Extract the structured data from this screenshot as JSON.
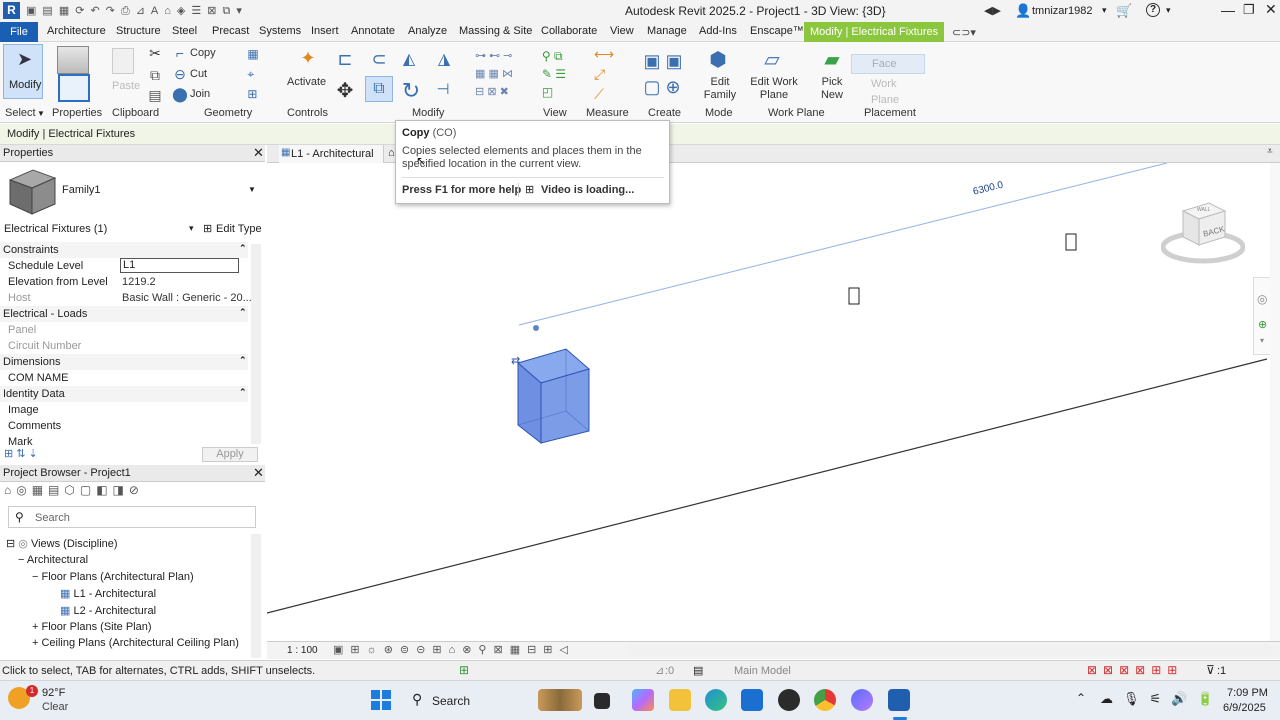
{
  "titlebar": {
    "title": "Autodesk Revit 2025.2 - Project1 - 3D View: {3D}",
    "user": "tmnizar1982",
    "app_icon_letter": "R"
  },
  "ribbon_tabs": [
    {
      "label": "File"
    },
    {
      "label": "Architecture"
    },
    {
      "label": "Structure"
    },
    {
      "label": "Steel"
    },
    {
      "label": "Precast"
    },
    {
      "label": "Systems"
    },
    {
      "label": "Insert"
    },
    {
      "label": "Annotate"
    },
    {
      "label": "Analyze"
    },
    {
      "label": "Massing & Site"
    },
    {
      "label": "Collaborate"
    },
    {
      "label": "View"
    },
    {
      "label": "Manage"
    },
    {
      "label": "Add-Ins"
    },
    {
      "label": "Enscape™"
    },
    {
      "label": "Modify | Electrical Fixtures"
    }
  ],
  "ribbon": {
    "modify_label": "Modify",
    "paste_label": "Paste",
    "properties_label": "Properties",
    "copy_label": "Copy",
    "cut_label": "Cut",
    "join_label": "Join",
    "activate_label": "Activate",
    "edit_family_label": "Edit Family",
    "edit_work_plane_label": "Edit Work Plane",
    "pick_new_label": "Pick New",
    "face_label": "Face",
    "work_plane_btn_label": "Work Plane",
    "panels": {
      "select": "Select",
      "properties": "Properties",
      "clipboard": "Clipboard",
      "geometry": "Geometry",
      "controls": "Controls",
      "modify": "Modify",
      "view": "View",
      "measure": "Measure",
      "create": "Create",
      "mode": "Mode",
      "work_plane": "Work Plane",
      "placement": "Placement"
    }
  },
  "context_bar": {
    "label": "Modify | Electrical Fixtures"
  },
  "tooltip": {
    "title": "Copy",
    "shortcut": "(CO)",
    "description": "Copies selected elements and places them in the specified location in the current view.",
    "help": "Press F1 for more help",
    "video": "Video is loading..."
  },
  "properties": {
    "header": "Properties",
    "family_name": "Family1",
    "selector": "Electrical Fixtures (1)",
    "edit_type": "Edit Type",
    "apply": "Apply",
    "sections": {
      "constraints": "Constraints",
      "electrical_loads": "Electrical - Loads",
      "dimensions": "Dimensions",
      "identity_data": "Identity Data"
    },
    "rows": {
      "schedule_level": {
        "key": "Schedule Level",
        "value": "L1"
      },
      "elevation": {
        "key": "Elevation from Level",
        "value": "1219.2"
      },
      "host": {
        "key": "Host",
        "value": "Basic Wall : Generic - 20..."
      },
      "panel": {
        "key": "Panel",
        "value": ""
      },
      "circuit_number": {
        "key": "Circuit Number",
        "value": ""
      },
      "com_name": {
        "key": "COM NAME",
        "value": ""
      },
      "image": {
        "key": "Image",
        "value": ""
      },
      "comments": {
        "key": "Comments",
        "value": ""
      },
      "mark": {
        "key": "Mark",
        "value": ""
      }
    }
  },
  "project_browser": {
    "header": "Project Browser - Project1",
    "search_placeholder": "Search",
    "nodes": {
      "views": "Views (Discipline)",
      "architectural": "Architectural",
      "floor_plans_arch": "Floor Plans (Architectural Plan)",
      "l1": "L1 - Architectural",
      "l2": "L2 - Architectural",
      "floor_plans_site": "Floor Plans (Site Plan)",
      "ceiling_plans": "Ceiling Plans (Architectural Ceiling Plan)"
    }
  },
  "view_tabs": [
    {
      "label": "L1 - Architectural"
    }
  ],
  "viewport": {
    "dimension": "6300.0",
    "viewcube_top": "WALL",
    "viewcube_face": "BACK"
  },
  "view_control": {
    "scale": "1 : 100"
  },
  "status": {
    "hint": "Click to select, TAB for alternates, CTRL adds, SHIFT unselects.",
    "count": ":0",
    "model": "Main Model",
    "filter_count": ":1"
  },
  "taskbar": {
    "weather_temp": "92°F",
    "weather_cond": "Clear",
    "weather_badge": "1",
    "search": "Search",
    "time": "7:09 PM",
    "date": "6/9/2025"
  },
  "colors": {
    "accent_blue": "#1a5fb4",
    "context_tab_green": "#8cc63f",
    "element_blue": "#6e93e8",
    "dimension_line": "#8fb2e6"
  }
}
